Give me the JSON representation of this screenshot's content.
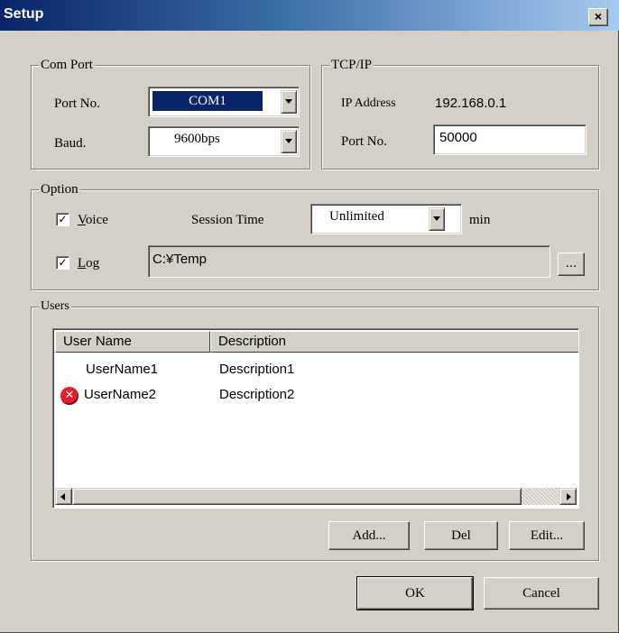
{
  "window": {
    "title": "Setup",
    "close_glyph": "×"
  },
  "com_port": {
    "group_label": "Com Port",
    "port_label": "Port No.",
    "port_value": "COM1",
    "baud_label": "Baud.",
    "baud_value": "9600bps"
  },
  "tcpip": {
    "group_label": "TCP/IP",
    "ip_label": "IP Address",
    "ip_value": "192.168.0.1",
    "port_label": "Port No.",
    "port_value": "50000"
  },
  "option": {
    "group_label": "Option",
    "voice": {
      "checked": true,
      "accel": "V",
      "rest": "oice"
    },
    "session_label": "Session Time",
    "session_value": "Unlimited",
    "session_unit": "min",
    "log": {
      "checked": true,
      "accel": "L",
      "rest": "og"
    },
    "log_path": "C:¥Temp",
    "browse_label": "..."
  },
  "users": {
    "group_label": "Users",
    "columns": [
      "User Name",
      "Description"
    ],
    "rows": [
      {
        "name": "UserName1",
        "description": "Description1",
        "icon": ""
      },
      {
        "name": "UserName2",
        "description": "Description2",
        "icon": "error-icon"
      }
    ],
    "add_label": "Add...",
    "del_label": "Del",
    "edit_label": "Edit..."
  },
  "footer": {
    "ok_label": "OK",
    "cancel_label": "Cancel"
  },
  "check_glyph": "✓",
  "error_glyph": "✕"
}
